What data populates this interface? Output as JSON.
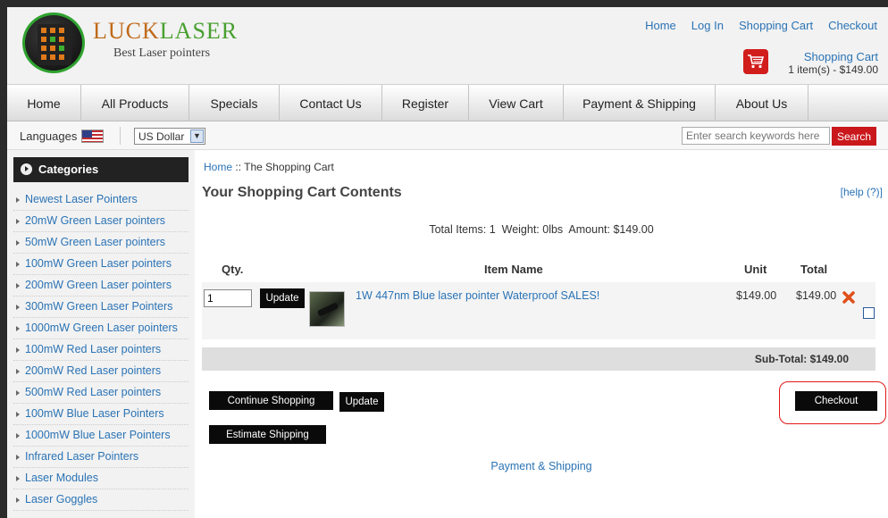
{
  "brand": {
    "part1": "LUCK",
    "part2": "LASER",
    "tagline": "Best Laser pointers"
  },
  "top_links": [
    "Home",
    "Log In",
    "Shopping Cart",
    "Checkout"
  ],
  "header_cart": {
    "link": "Shopping Cart",
    "summary": "1 item(s) - $149.00",
    "icon": "shopping-cart-icon"
  },
  "nav": [
    "Home",
    "All Products",
    "Specials",
    "Contact Us",
    "Register",
    "View Cart",
    "Payment & Shipping",
    "About Us"
  ],
  "toolbar": {
    "languages_label": "Languages",
    "flag_icon": "us-flag-icon",
    "currency": "US Dollar",
    "search_placeholder": "Enter search keywords here",
    "search_button": "Search"
  },
  "sidebar": {
    "title": "Categories",
    "items": [
      "Newest Laser Pointers",
      "20mW Green Laser pointers",
      "50mW Green Laser pointers",
      "100mW Green Laser pointers",
      "200mW Green Laser pointers",
      "300mW Green Laser Pointers",
      "1000mW Green Laser pointers",
      "100mW Red Laser pointers",
      "200mW Red Laser pointers",
      "500mW Red Laser pointers",
      "100mW Blue Laser Pointers",
      "1000mW Blue Laser Pointers",
      "Infrared Laser Pointers",
      "Laser Modules",
      "Laser Goggles"
    ]
  },
  "breadcrumb": {
    "home": "Home",
    "sep": "::",
    "current": "The Shopping Cart"
  },
  "cart": {
    "heading": "Your Shopping Cart Contents",
    "help": "[help (?)]",
    "totals_line": "Total Items: 1  Weight: 0lbs  Amount: $149.00",
    "columns": {
      "qty": "Qty.",
      "item": "Item Name",
      "unit": "Unit",
      "total": "Total"
    },
    "item": {
      "qty": "1",
      "update": "Update",
      "name": "1W 447nm Blue laser pointer Waterproof SALES!",
      "unit": "$149.00",
      "total": "$149.00",
      "delete_icon": "delete-x-icon"
    },
    "subtotal": "Sub-Total: $149.00",
    "buttons": {
      "continue": "Continue Shopping",
      "update": "Update",
      "checkout": "Checkout",
      "estimate": "Estimate Shipping"
    },
    "payment_link": "Payment & Shipping"
  }
}
